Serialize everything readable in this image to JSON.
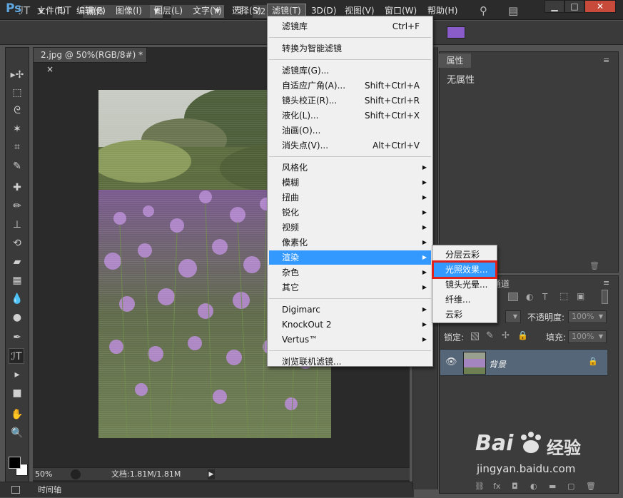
{
  "app": {
    "logo": "Ps"
  },
  "menubar": {
    "items": [
      "文件(F)",
      "编辑(E)",
      "图像(I)",
      "图层(L)",
      "文字(Y)",
      "选择(S)",
      "滤镜(T)",
      "3D(D)",
      "视图(V)",
      "窗口(W)",
      "帮助(H)"
    ],
    "active": "滤镜(T)"
  },
  "window_buttons": {
    "minimize": "▁",
    "maximize": "□",
    "close": "✕"
  },
  "options_bar": {
    "font_family": "黑体",
    "font_style": "-",
    "font_size": "72"
  },
  "document": {
    "tab_title": "2.jpg @ 50%(RGB/8#) *",
    "tab_close": "×",
    "zoom": "50%",
    "doc_info": "文档:1.81M/1.81M",
    "timeline_label": "时间轴"
  },
  "filter_menu": {
    "top": [
      {
        "label": "滤镜库",
        "shortcut": "Ctrl+F"
      }
    ],
    "convert": "转换为智能滤镜",
    "group1": [
      {
        "label": "滤镜库(G)...",
        "shortcut": ""
      },
      {
        "label": "自适应广角(A)...",
        "shortcut": "Shift+Ctrl+A"
      },
      {
        "label": "镜头校正(R)...",
        "shortcut": "Shift+Ctrl+R"
      },
      {
        "label": "液化(L)...",
        "shortcut": "Shift+Ctrl+X"
      },
      {
        "label": "油画(O)...",
        "shortcut": ""
      },
      {
        "label": "消失点(V)...",
        "shortcut": "Alt+Ctrl+V"
      }
    ],
    "group2": [
      "风格化",
      "模糊",
      "扭曲",
      "锐化",
      "视频",
      "像素化",
      "渲染",
      "杂色",
      "其它"
    ],
    "group2_highlight": "渲染",
    "group3": [
      "Digimarc",
      "KnockOut 2",
      "Vertus™"
    ],
    "browse": "浏览联机滤镜..."
  },
  "render_submenu": {
    "items": [
      "分层云彩",
      "光照效果...",
      "镜头光晕...",
      "纤维...",
      "云彩"
    ],
    "highlight": "光照效果..."
  },
  "properties_panel": {
    "tab": "属性",
    "content": "无属性"
  },
  "layers_panel": {
    "tab_partial": "通道",
    "opacity_label": "不透明度:",
    "opacity_value": "100%",
    "lock_label": "锁定:",
    "fill_label": "填充:",
    "fill_value": "100%",
    "layer_name": "背景"
  },
  "watermark": {
    "brand": "Bai",
    "brand2": "经验",
    "url": "jingyan.baidu.com"
  }
}
